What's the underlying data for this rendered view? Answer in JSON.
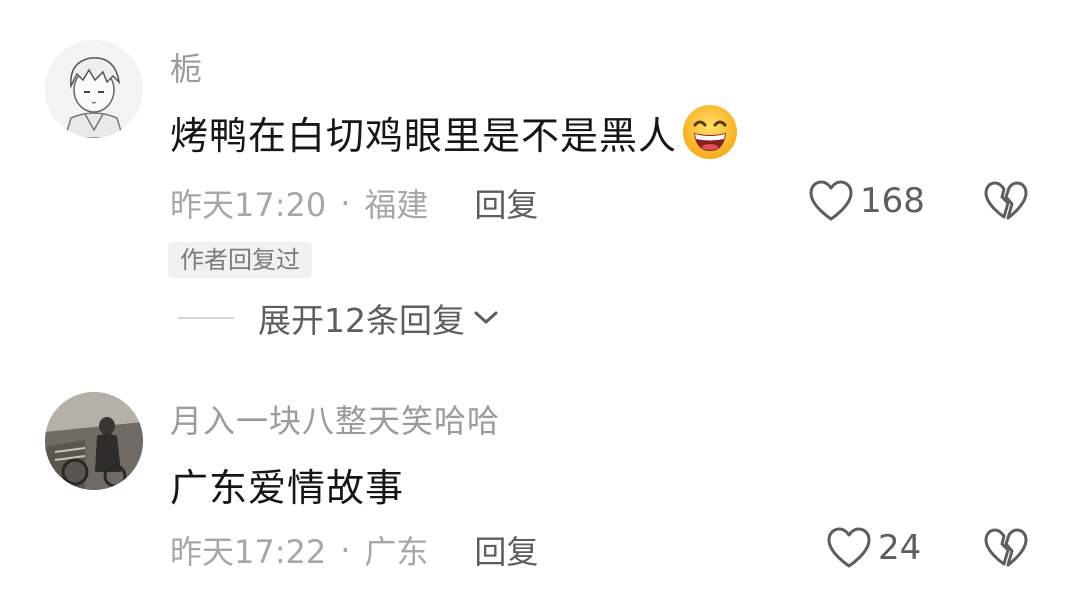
{
  "comments": [
    {
      "username": "栀",
      "text": "烤鸭在白切鸡眼里是不是黑人",
      "emoji": "grinning-face-emoji",
      "time": "昨天17:20",
      "separator": "·",
      "location": "福建",
      "reply_label": "回复",
      "likes": "168",
      "author_replied_badge": "作者回复过",
      "expand_replies_label": "展开12条回复"
    },
    {
      "username": "月入一块八整天笑哈哈",
      "text": "广东爱情故事",
      "time": "昨天17:22",
      "separator": "·",
      "location": "广东",
      "reply_label": "回复",
      "likes": "24"
    }
  ],
  "icons": {
    "like": "heart-outline-icon",
    "dislike": "broken-heart-icon",
    "expand": "chevron-down-icon"
  }
}
